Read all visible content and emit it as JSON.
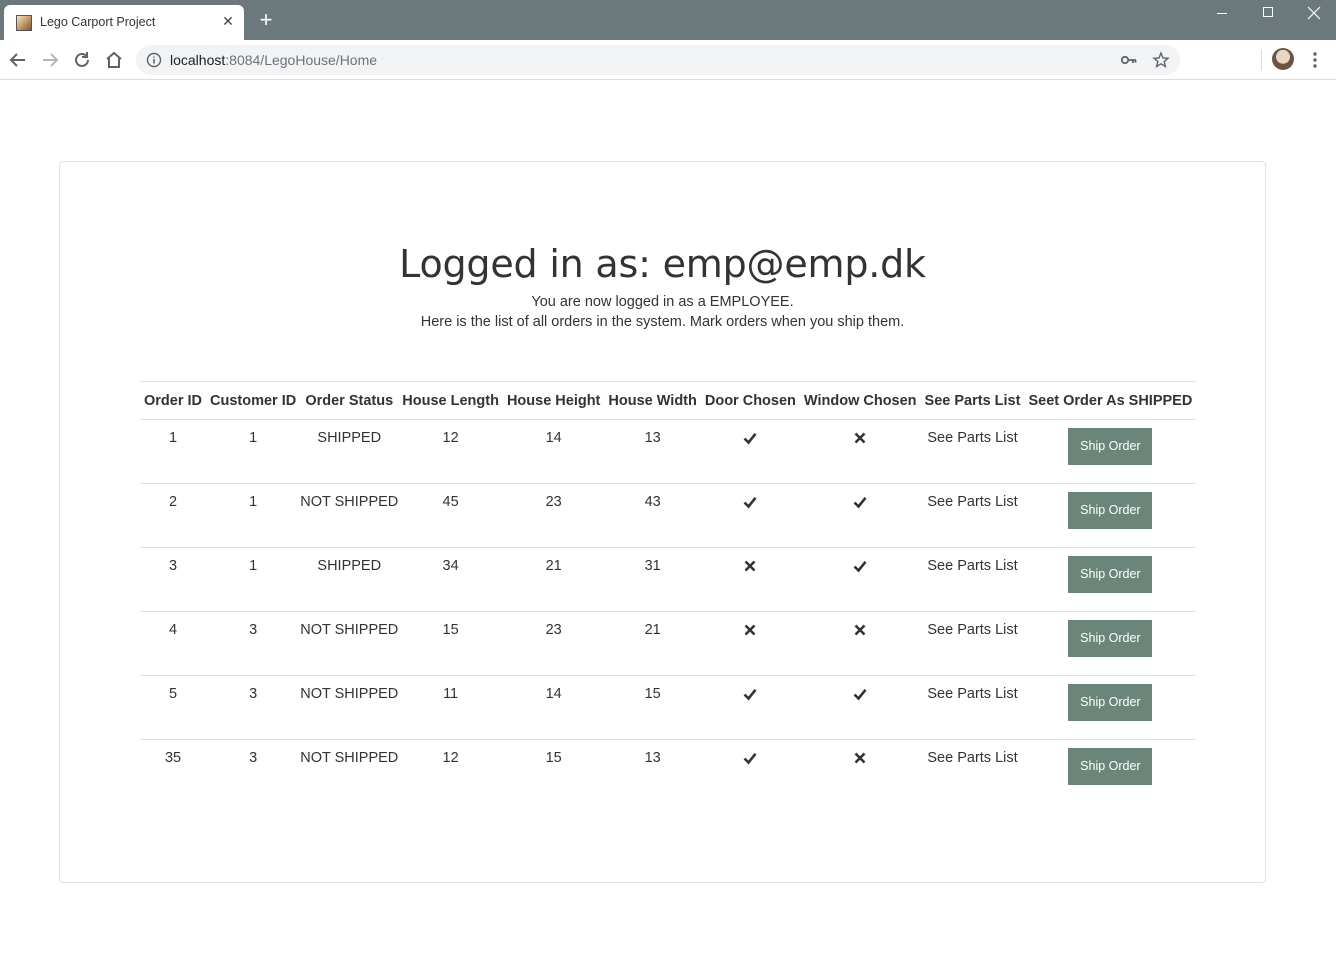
{
  "browser": {
    "tab_title": "Lego Carport Project",
    "url_host": "localhost",
    "url_rest": ":8084/LegoHouse/Home"
  },
  "page": {
    "heading": "Logged in as: emp@emp.dk",
    "line1": "You are now logged in as a EMPLOYEE.",
    "line2": "Here is the list of all orders in the system. Mark orders when you ship them."
  },
  "table": {
    "headers": [
      "Order ID",
      "Customer ID",
      "Order Status",
      "House Length",
      "House Height",
      "House Width",
      "Door Chosen",
      "Window Chosen",
      "See Parts List",
      "Seet Order As SHIPPED"
    ],
    "rows": [
      {
        "order_id": "1",
        "customer_id": "1",
        "status": "SHIPPED",
        "length": "12",
        "height": "14",
        "width": "13",
        "door": true,
        "window": false,
        "parts_link": "See Parts List",
        "button": "Ship Order"
      },
      {
        "order_id": "2",
        "customer_id": "1",
        "status": "NOT SHIPPED",
        "length": "45",
        "height": "23",
        "width": "43",
        "door": true,
        "window": true,
        "parts_link": "See Parts List",
        "button": "Ship Order"
      },
      {
        "order_id": "3",
        "customer_id": "1",
        "status": "SHIPPED",
        "length": "34",
        "height": "21",
        "width": "31",
        "door": false,
        "window": true,
        "parts_link": "See Parts List",
        "button": "Ship Order"
      },
      {
        "order_id": "4",
        "customer_id": "3",
        "status": "NOT SHIPPED",
        "length": "15",
        "height": "23",
        "width": "21",
        "door": false,
        "window": false,
        "parts_link": "See Parts List",
        "button": "Ship Order"
      },
      {
        "order_id": "5",
        "customer_id": "3",
        "status": "NOT SHIPPED",
        "length": "11",
        "height": "14",
        "width": "15",
        "door": true,
        "window": true,
        "parts_link": "See Parts List",
        "button": "Ship Order"
      },
      {
        "order_id": "35",
        "customer_id": "3",
        "status": "NOT SHIPPED",
        "length": "12",
        "height": "15",
        "width": "13",
        "door": true,
        "window": false,
        "parts_link": "See Parts List",
        "button": "Ship Order"
      }
    ]
  },
  "colors": {
    "tabbar": "#6b797c",
    "ship_button": "#6b857a"
  }
}
